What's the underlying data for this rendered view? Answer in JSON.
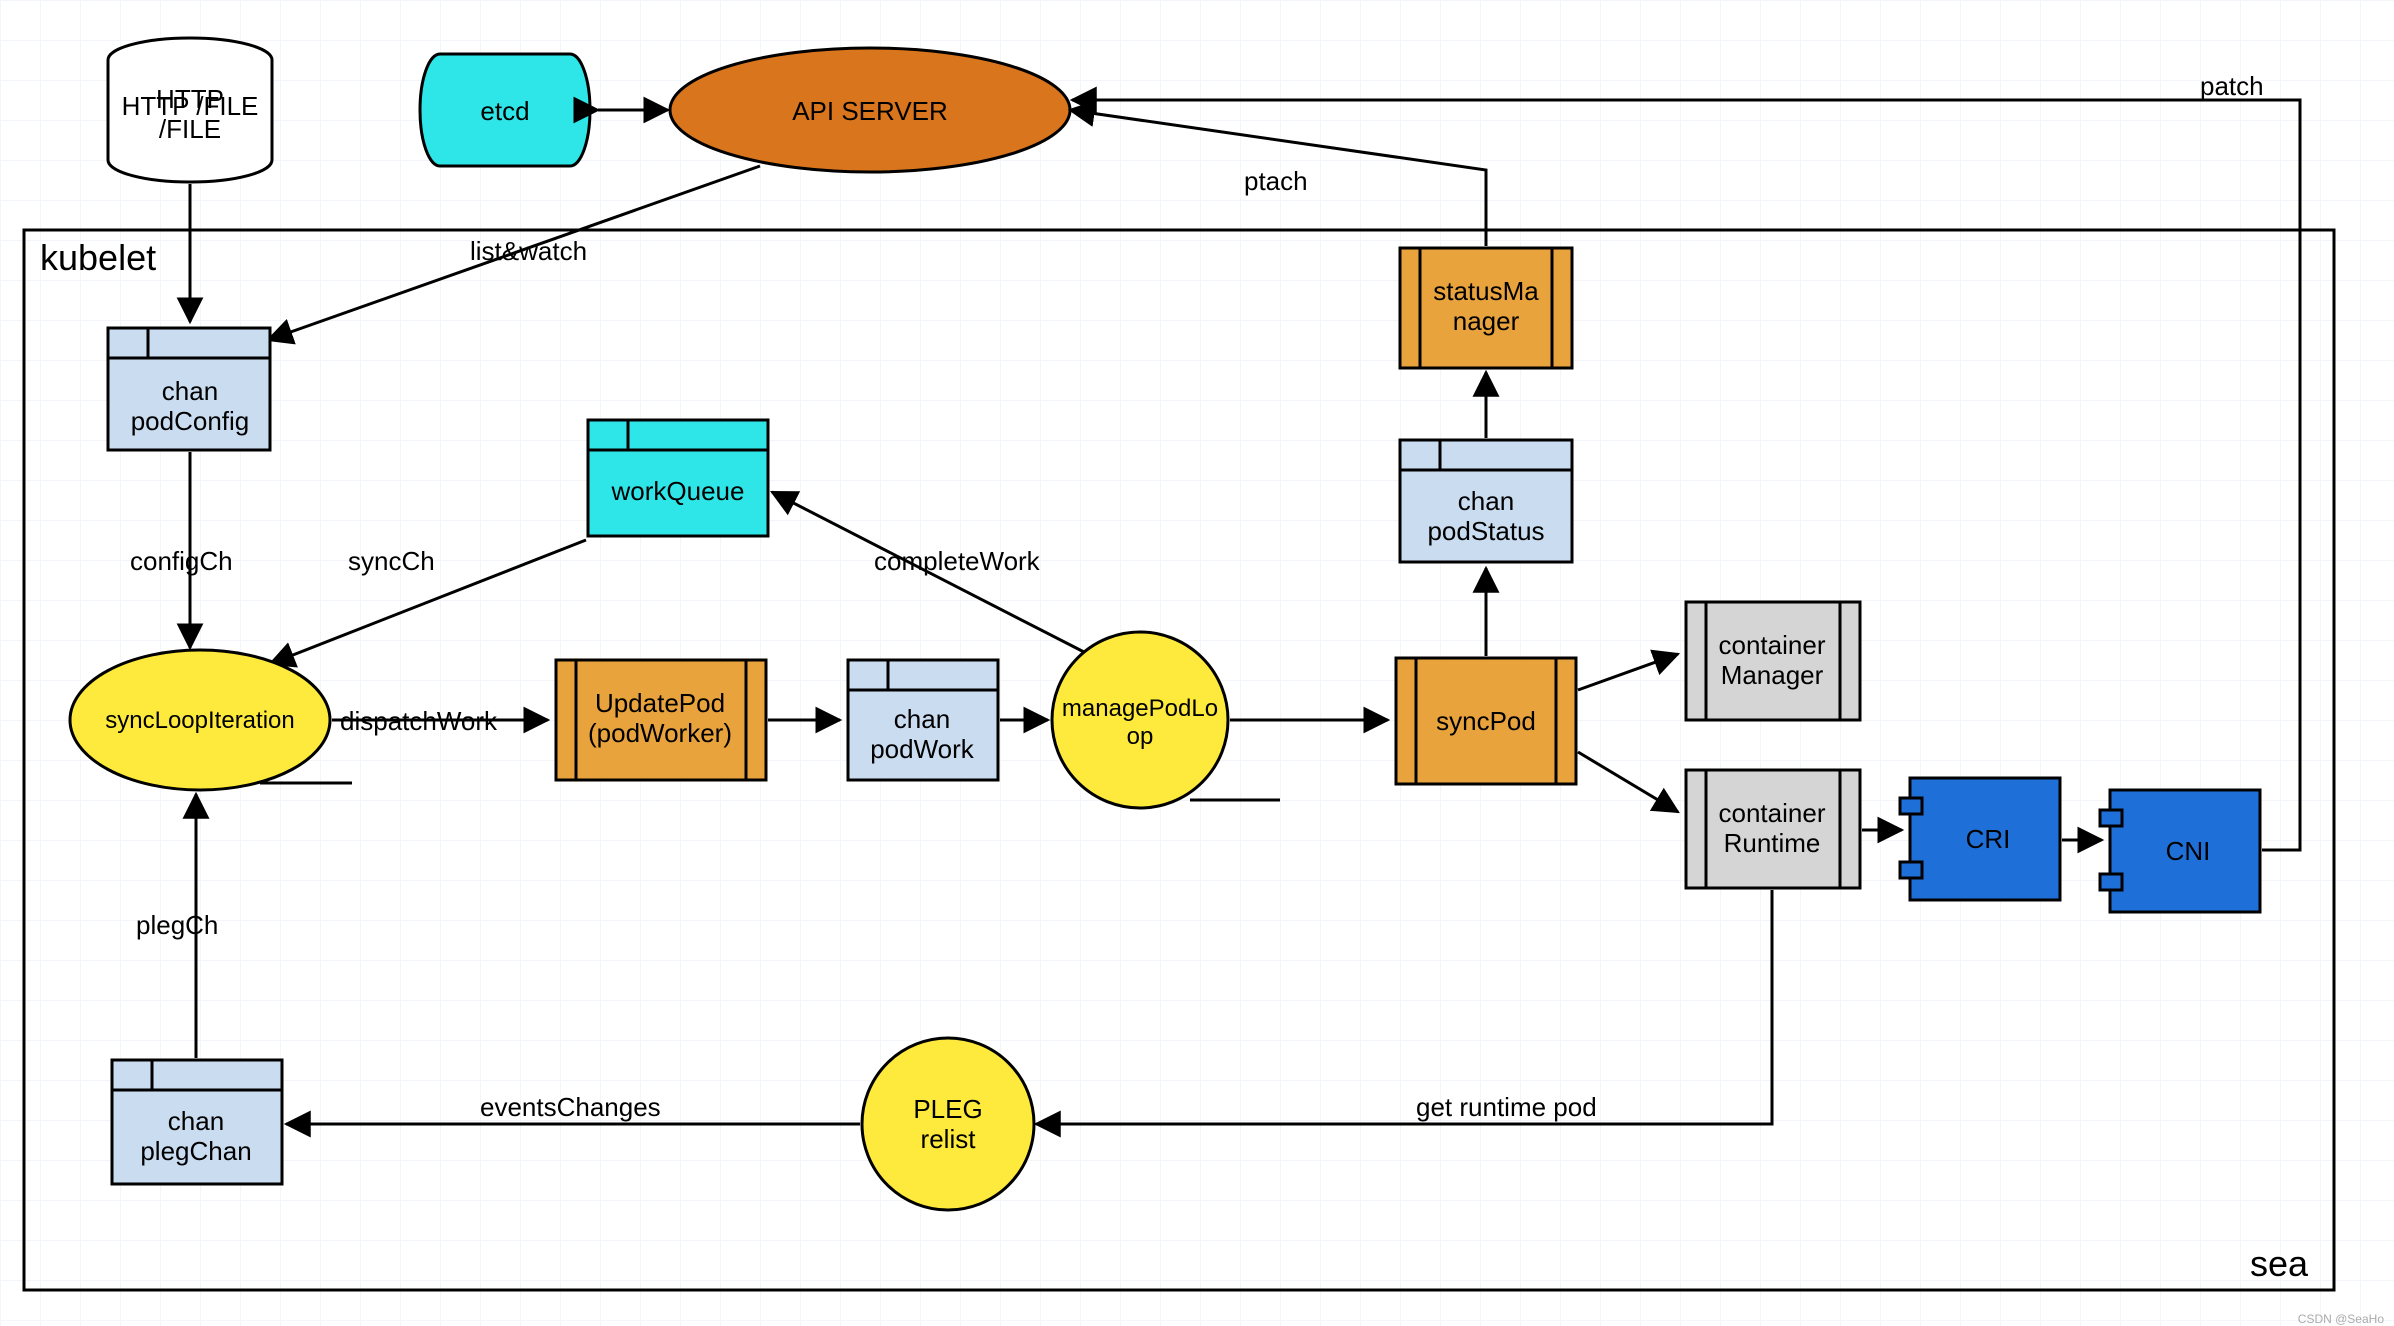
{
  "title": "kubelet",
  "signature": "sea",
  "watermark": "CSDN @SeaHo",
  "nodes": {
    "httpFile": "HTTP\n/FILE",
    "etcd": "etcd",
    "apiServer": "API SERVER",
    "chanPodConfig": "chan\npodConfig",
    "workQueue": "workQueue",
    "syncLoopIteration": "syncLoopIteration",
    "updatePod": "UpdatePod\n(podWorker)",
    "chanPodWork": "chan\npodWork",
    "managePodLoop": "managePodLo\nop",
    "syncPod": "syncPod",
    "chanPodStatus": "chan\npodStatus",
    "statusManager": "statusMa\nnager",
    "containerManager": "container\nManager",
    "containerRuntime": "container\nRuntime",
    "cri": "CRI",
    "cni": "CNI",
    "plegRelist": "PLEG\nrelist",
    "chanPlegChan": "chan\nplegChan"
  },
  "edges": {
    "listWatch": "list&watch",
    "configCh": "configCh",
    "syncCh": "syncCh",
    "completeWork": "completeWork",
    "dispatchWork": "dispatchWork",
    "plegCh": "plegCh",
    "eventsChanges": "eventsChanges",
    "getRuntimePod": "get runtime pod",
    "ptach": "ptach",
    "patch": "patch"
  },
  "colors": {
    "cyan": "#2ee6e8",
    "orange": "#d9751c",
    "orange2": "#e8a33d",
    "lightBlue": "#cadcf0",
    "blue": "#1f6fd9",
    "yellow": "#fdea3c",
    "grey": "#d5d5d5"
  }
}
